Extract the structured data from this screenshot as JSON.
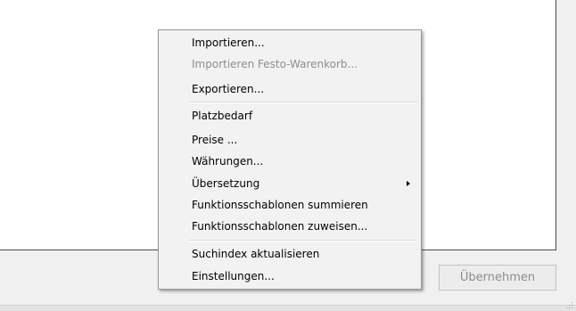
{
  "dialog": {
    "apply_button_label": "Übernehmen"
  },
  "context_menu": {
    "items": [
      {
        "label": "Importieren...",
        "enabled": true
      },
      {
        "label": "Importieren Festo-Warenkorb...",
        "enabled": false
      },
      {
        "label": "Exportieren...",
        "enabled": true
      },
      {
        "label": "Platzbedarf",
        "enabled": true
      },
      {
        "label": "Preise ...",
        "enabled": true
      },
      {
        "label": "Währungen...",
        "enabled": true
      },
      {
        "label": "Übersetzung",
        "enabled": true,
        "has_submenu": true
      },
      {
        "label": "Funktionsschablonen summieren",
        "enabled": true
      },
      {
        "label": "Funktionsschablonen zuweisen...",
        "enabled": true
      },
      {
        "label": "Suchindex aktualisieren",
        "enabled": true
      },
      {
        "label": "Einstellungen...",
        "enabled": true
      }
    ]
  },
  "colors": {
    "menu_background": "#f2f2f2",
    "disabled_text": "#8d8d8d",
    "separator": "#d7d7d7"
  }
}
